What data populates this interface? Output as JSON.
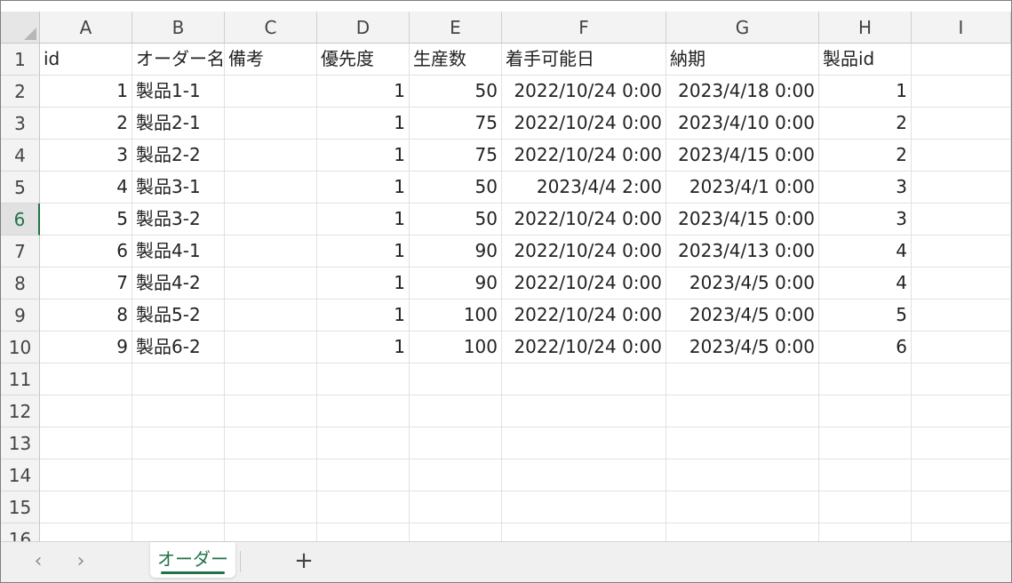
{
  "columns": [
    "A",
    "B",
    "C",
    "D",
    "E",
    "F",
    "G",
    "H",
    "I"
  ],
  "rows": [
    "1",
    "2",
    "3",
    "4",
    "5",
    "6",
    "7",
    "8",
    "9",
    "10",
    "11",
    "12",
    "13",
    "14",
    "15",
    "16"
  ],
  "active_row": "6",
  "header_row": [
    "id",
    "オーダー名",
    "備考",
    "優先度",
    "生産数",
    "着手可能日",
    "納期",
    "製品id",
    ""
  ],
  "data_rows": [
    [
      "1",
      "製品1-1",
      "",
      "1",
      "50",
      "2022/10/24 0:00",
      "2023/4/18 0:00",
      "1"
    ],
    [
      "2",
      "製品2-1",
      "",
      "1",
      "75",
      "2022/10/24 0:00",
      "2023/4/10 0:00",
      "2"
    ],
    [
      "3",
      "製品2-2",
      "",
      "1",
      "75",
      "2022/10/24 0:00",
      "2023/4/15 0:00",
      "2"
    ],
    [
      "4",
      "製品3-1",
      "",
      "1",
      "50",
      "2023/4/4 2:00",
      "2023/4/1 0:00",
      "3"
    ],
    [
      "5",
      "製品3-2",
      "",
      "1",
      "50",
      "2022/10/24 0:00",
      "2023/4/15 0:00",
      "3"
    ],
    [
      "6",
      "製品4-1",
      "",
      "1",
      "90",
      "2022/10/24 0:00",
      "2023/4/13 0:00",
      "4"
    ],
    [
      "7",
      "製品4-2",
      "",
      "1",
      "90",
      "2022/10/24 0:00",
      "2023/4/5 0:00",
      "4"
    ],
    [
      "8",
      "製品5-2",
      "",
      "1",
      "100",
      "2022/10/24 0:00",
      "2023/4/5 0:00",
      "5"
    ],
    [
      "9",
      "製品6-2",
      "",
      "1",
      "100",
      "2022/10/24 0:00",
      "2023/4/5 0:00",
      "6"
    ]
  ],
  "sheet_tabs": [
    {
      "label": "オーダー",
      "active": true
    }
  ],
  "nav": {
    "prev_icon": "‹",
    "next_icon": "›",
    "add_icon": "+"
  },
  "colors": {
    "accent": "#217346",
    "header_bg": "#f3f3f3",
    "gridline": "#e1e1e1"
  }
}
